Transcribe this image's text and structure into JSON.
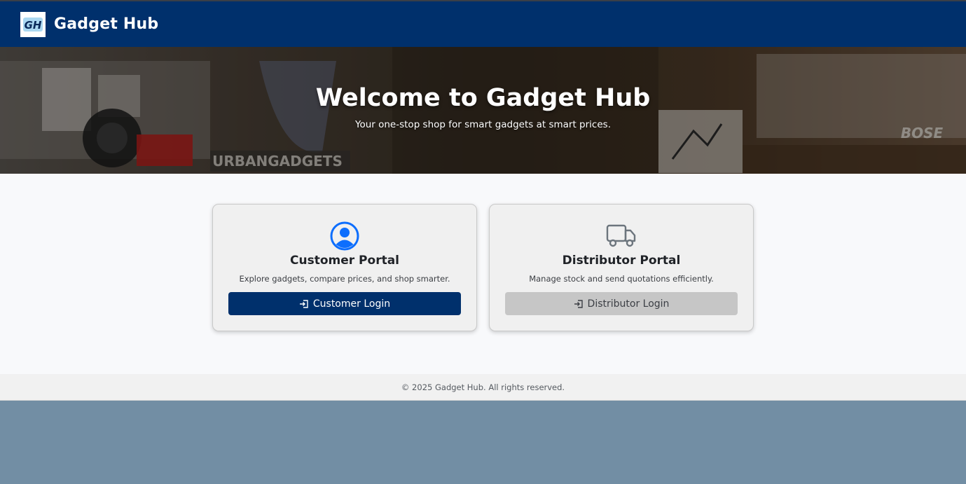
{
  "navbar": {
    "logo_text": "GH",
    "brand": "Gadget Hub"
  },
  "hero": {
    "title": "Welcome to Gadget Hub",
    "subtitle": "Your one-stop shop for smart gadgets at smart prices.",
    "background_signs": [
      "URBANGADGETS",
      "BOSE"
    ]
  },
  "portals": [
    {
      "title": "Customer Portal",
      "description": "Explore gadgets, compare prices, and shop smarter.",
      "button_label": "Customer Login",
      "icon": "user-circle-icon",
      "button_color": "#00306c"
    },
    {
      "title": "Distributor Portal",
      "description": "Manage stock and send quotations efficiently.",
      "button_label": "Distributor Login",
      "icon": "truck-icon",
      "button_color": "#c6c6c6"
    }
  ],
  "footer": {
    "text": "© 2025 Gadget Hub. All rights reserved."
  },
  "colors": {
    "primary": "#00306c",
    "accent_icon": "#0d6efd",
    "page_bg": "#728ea4"
  }
}
